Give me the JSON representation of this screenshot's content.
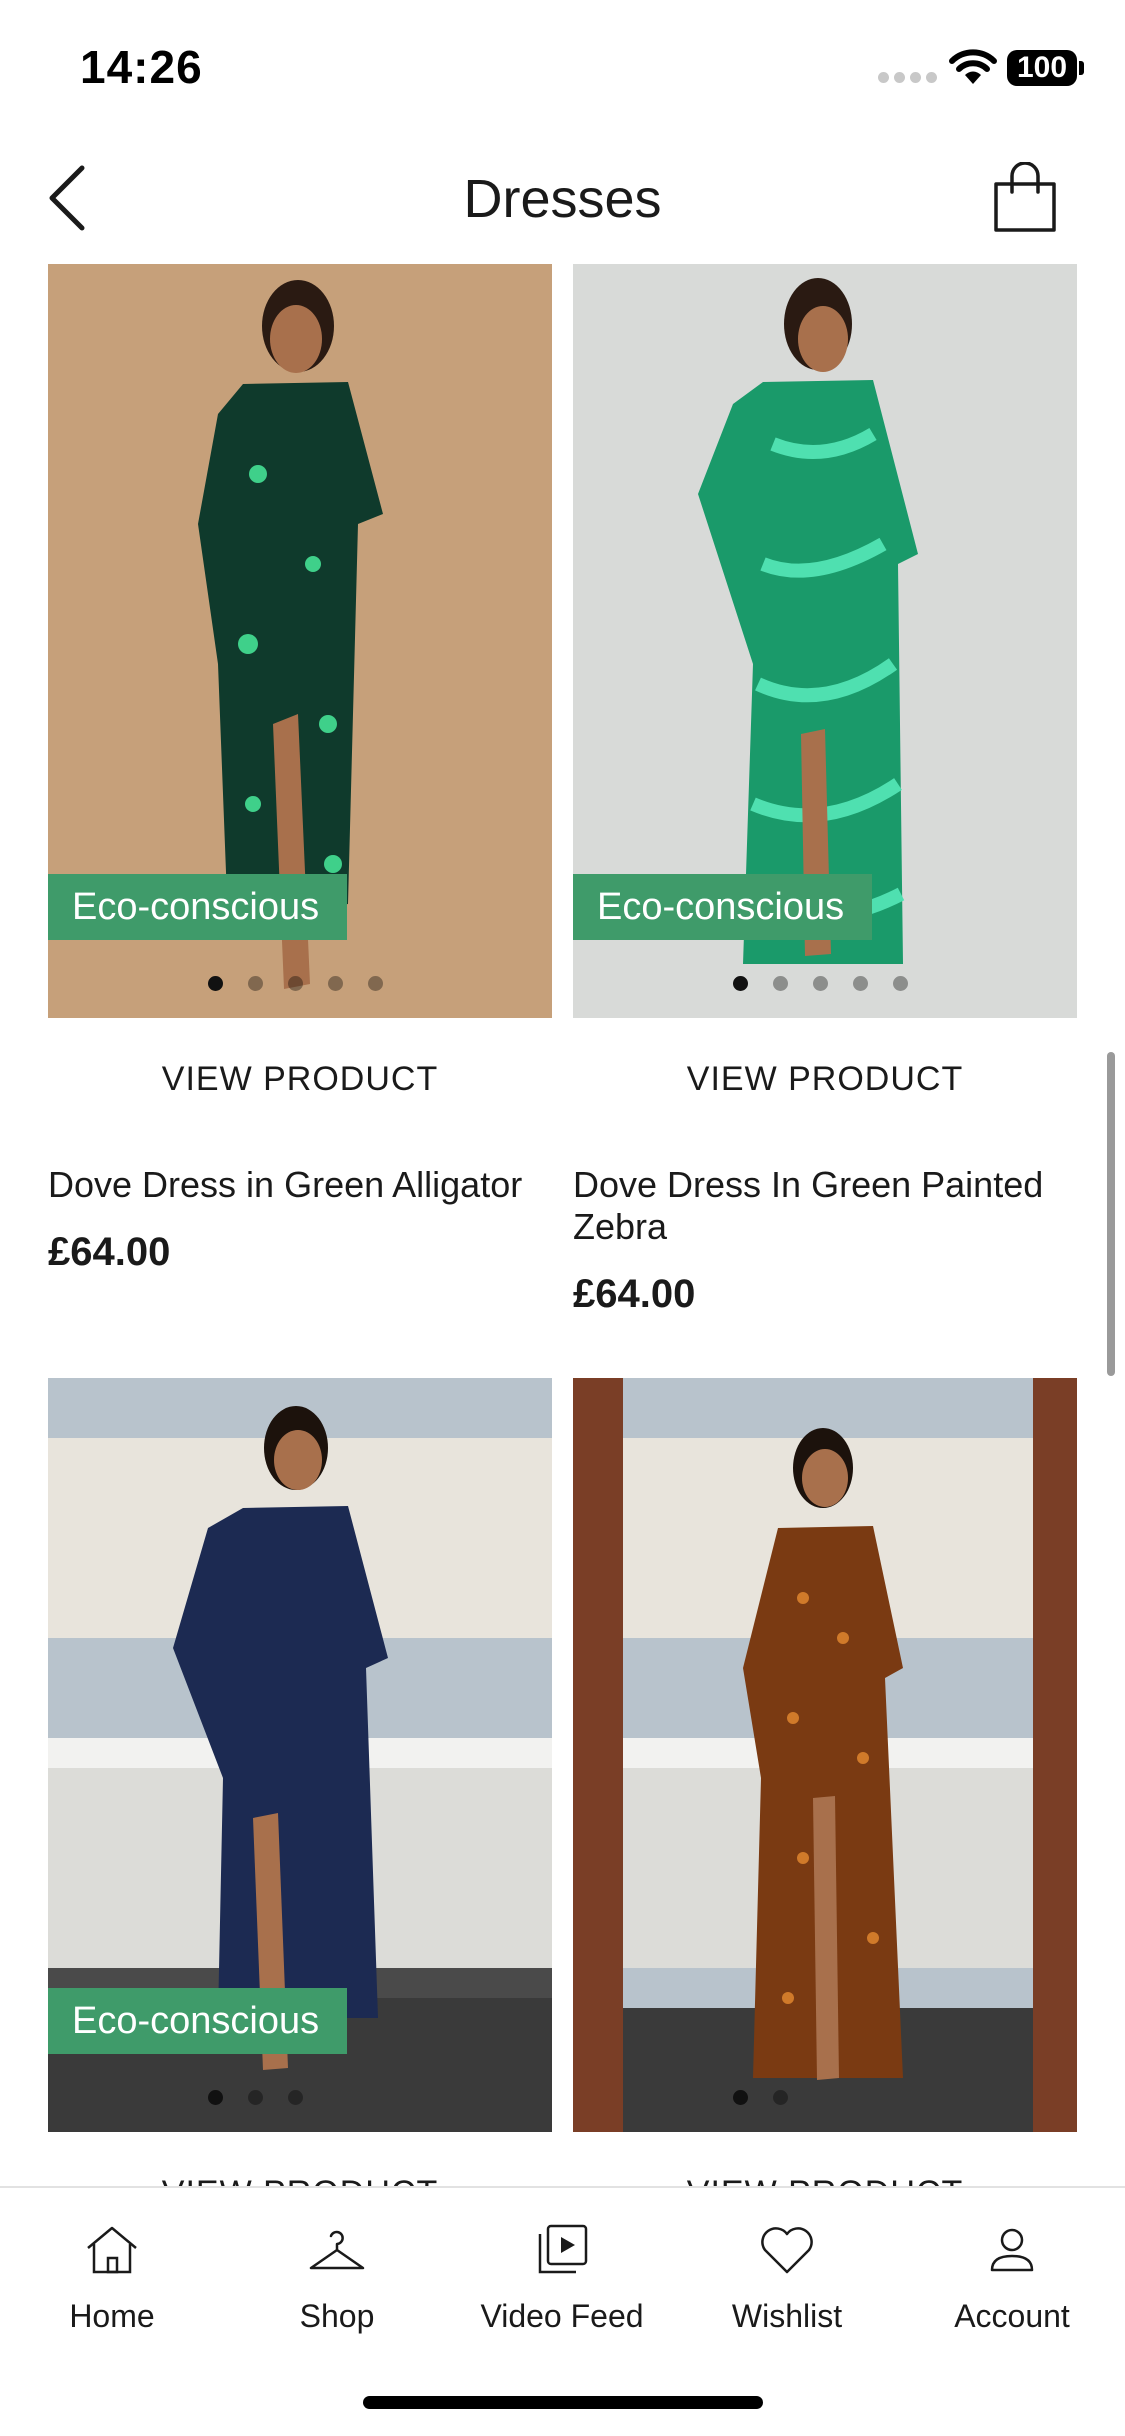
{
  "status_bar": {
    "time": "14:26",
    "battery": "100"
  },
  "header": {
    "title": "Dresses"
  },
  "products": [
    {
      "badge": "Eco-conscious",
      "view_label": "VIEW PRODUCT",
      "name": "Dove Dress in Green Alligator",
      "price": "£64.00",
      "image_dots": 5,
      "active_dot": 0,
      "colors": {
        "background": "#c6a07a",
        "dress": "#0f3a2c",
        "accent": "#3fd08a"
      }
    },
    {
      "badge": "Eco-conscious",
      "view_label": "VIEW PRODUCT",
      "name": "Dove Dress In Green Painted Zebra",
      "price": "£64.00",
      "image_dots": 5,
      "active_dot": 0,
      "colors": {
        "background": "#d8dad8",
        "dress": "#1a9a6a",
        "accent": "#4fe0b0"
      }
    },
    {
      "badge": "Eco-conscious",
      "view_label": "VIEW PRODUCT",
      "image_dots": 3,
      "active_dot": 0,
      "colors": {
        "background": "#b8c3cc",
        "dress": "#1c2a52",
        "accent": "#2e3f6e"
      }
    },
    {
      "view_label": "VIEW PRODUCT",
      "image_dots": 2,
      "active_dot": 0,
      "colors": {
        "background": "#b8c3cc",
        "dress": "#7a3a12",
        "accent": "#d07a2a"
      }
    }
  ],
  "tabs": [
    {
      "label": "Home",
      "icon": "home-icon"
    },
    {
      "label": "Shop",
      "icon": "hanger-icon"
    },
    {
      "label": "Video Feed",
      "icon": "video-feed-icon"
    },
    {
      "label": "Wishlist",
      "icon": "heart-icon"
    },
    {
      "label": "Account",
      "icon": "person-icon"
    }
  ],
  "theme": {
    "badge_color": "#3f9b6a",
    "text_color": "#1a1a1a"
  }
}
